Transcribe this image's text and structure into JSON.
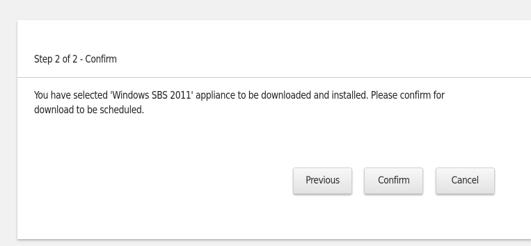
{
  "dialog": {
    "title": "Step 2 of 2 - Confirm",
    "message": "You have selected 'Windows SBS 2011' appliance to be downloaded and installed. Please confirm for download to be scheduled.",
    "buttons": {
      "previous": "Previous",
      "confirm": "Confirm",
      "cancel": "Cancel"
    }
  },
  "colors": {
    "background": "#f1f1f1",
    "panel": "#ffffff",
    "divider": "#c9c9c9",
    "button_face": "#eeeeee"
  }
}
